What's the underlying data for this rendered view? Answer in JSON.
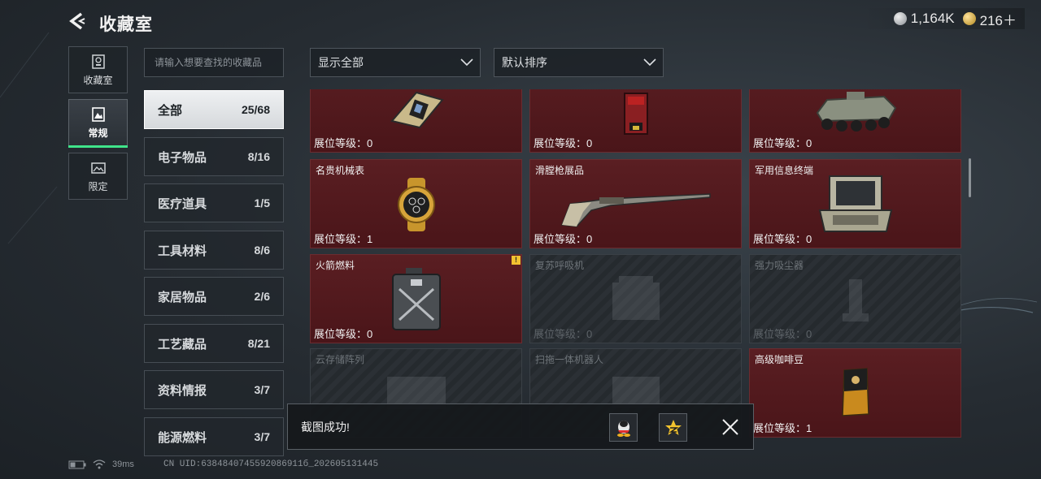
{
  "header": {
    "title": "收藏室",
    "silver": "1,164K",
    "gold": "216＋"
  },
  "side_tabs": [
    {
      "label": "收藏室",
      "icon": "badge-icon"
    },
    {
      "label": "常规",
      "icon": "picture-frame-icon"
    },
    {
      "label": "限定",
      "icon": "limited-frame-icon"
    }
  ],
  "search": {
    "placeholder": "请输入想要查找的收藏品"
  },
  "filters": {
    "show": "显示全部",
    "sort": "默认排序"
  },
  "categories": [
    {
      "name": "全部",
      "count": "25/68"
    },
    {
      "name": "电子物品",
      "count": "8/16"
    },
    {
      "name": "医疗道具",
      "count": "1/5"
    },
    {
      "name": "工具材料",
      "count": "8/6"
    },
    {
      "name": "家居物品",
      "count": "2/6"
    },
    {
      "name": "工艺藏品",
      "count": "8/21"
    },
    {
      "name": "资料情报",
      "count": "3/7"
    },
    {
      "name": "能源燃料",
      "count": "3/7"
    }
  ],
  "items": [
    {
      "name": "",
      "level": "展位等级：0",
      "icon": "circuit-board-icon"
    },
    {
      "name": "",
      "level": "展位等级：0",
      "icon": "red-case-icon"
    },
    {
      "name": "",
      "level": "展位等级：0",
      "icon": "armored-vehicle-icon"
    },
    {
      "name": "名贵机械表",
      "level": "展位等级：1",
      "icon": "watch-icon"
    },
    {
      "name": "滑膛枪展品",
      "level": "展位等级：0",
      "icon": "musket-icon"
    },
    {
      "name": "军用信息终端",
      "level": "展位等级：0",
      "icon": "terminal-case-icon"
    },
    {
      "name": "火箭燃料",
      "level": "展位等级：0",
      "icon": "fuel-canister-icon",
      "warning": "!"
    },
    {
      "name": "复苏呼吸机",
      "level": "展位等级：0",
      "icon": "ventilator-icon"
    },
    {
      "name": "强力吸尘器",
      "level": "展位等级：0",
      "icon": "vacuum-icon"
    },
    {
      "name": "云存储阵列",
      "level": "",
      "icon": "storage-array-icon"
    },
    {
      "name": "扫拖一体机器人",
      "level": "",
      "icon": "robot-vacuum-icon"
    },
    {
      "name": "高级咖啡豆",
      "level": "展位等级：1",
      "icon": "coffee-bag-icon"
    }
  ],
  "toast": {
    "message": "截图成功!"
  },
  "status": {
    "ping": "39ms",
    "uid": "CN UID:6384840745592086911б_202605131445"
  }
}
